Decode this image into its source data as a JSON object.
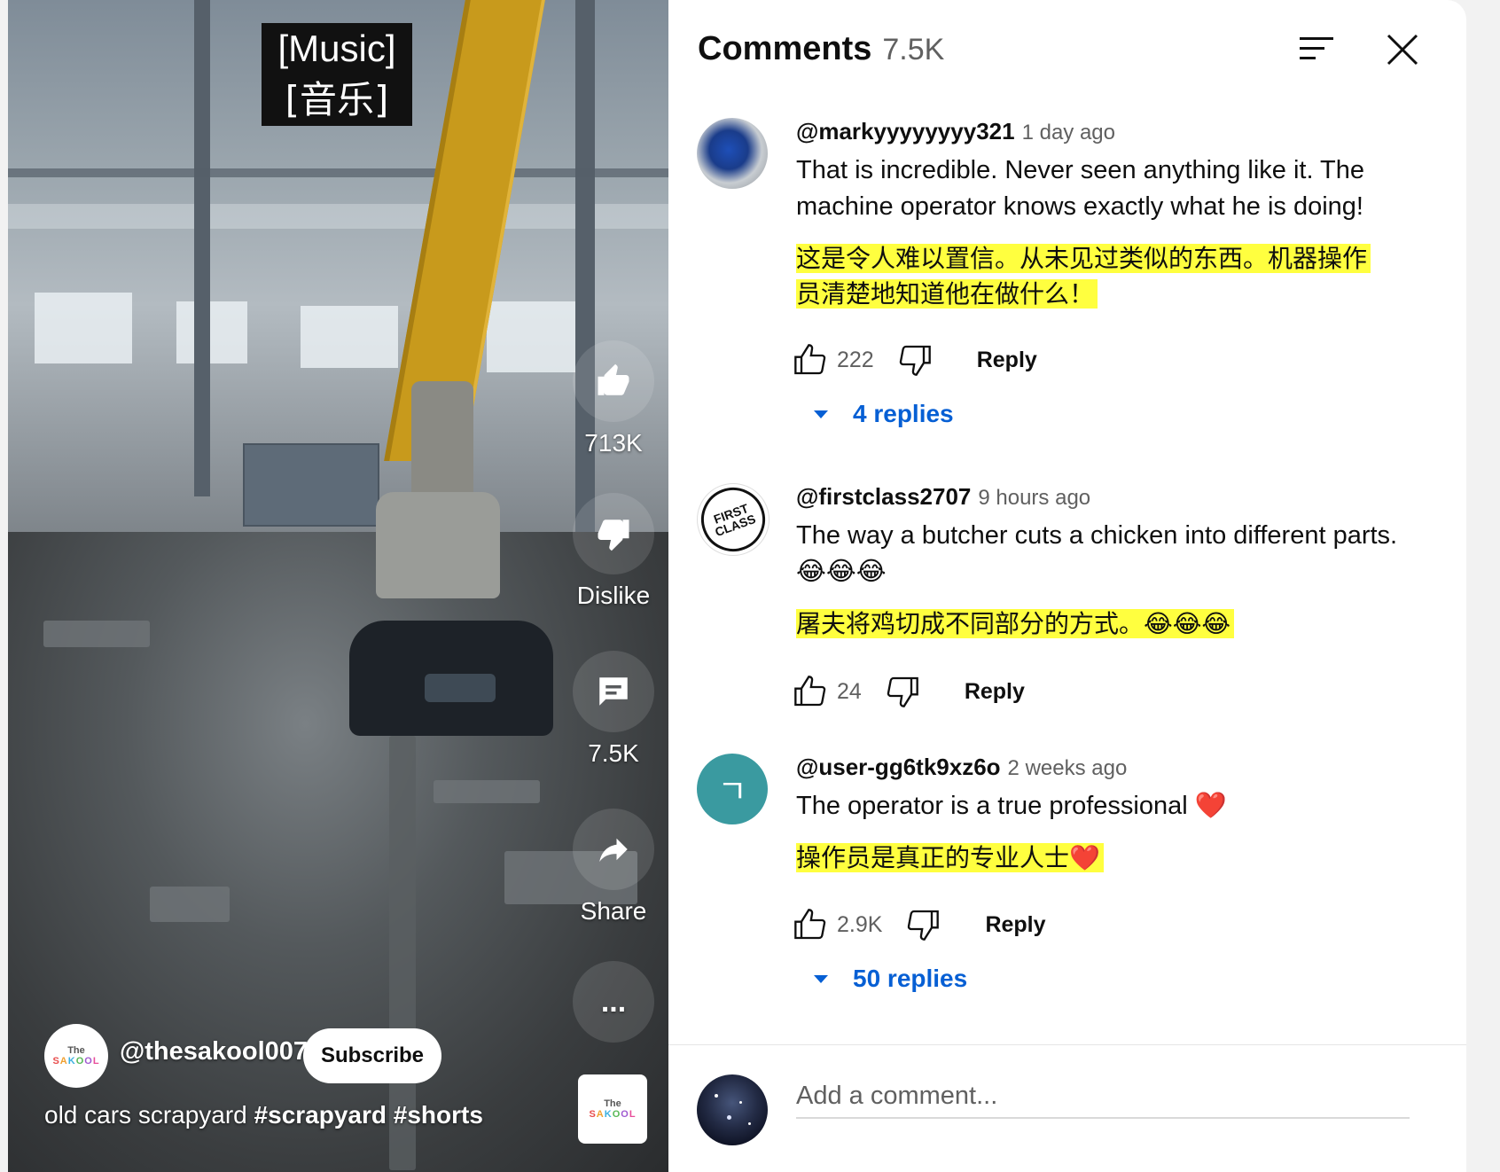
{
  "video": {
    "caption_line1": "[Music]",
    "caption_line2": "[音乐]",
    "like_count": "713K",
    "dislike_label": "Dislike",
    "comment_count": "7.5K",
    "share_label": "Share",
    "more_label": "...",
    "channel_name": "@thesakool007",
    "subscribe_label": "Subscribe",
    "title_text": "old cars scrapyard ",
    "title_tags": "#scrapyard #shorts",
    "logo_top": "The",
    "logo_letters": [
      "S",
      "A",
      "K",
      "O",
      "O",
      "L"
    ]
  },
  "comments_panel": {
    "title": "Comments",
    "count": "7.5K",
    "sort_icon": "sort-icon",
    "close_icon": "close-icon",
    "comments": [
      {
        "author": "@markyyyyyyyy321",
        "time": "1 day ago",
        "text": "That is incredible. Never seen anything like it. The machine operator knows exactly what he is doing!",
        "translation": "这是令人难以置信。从未见过类似的东西。机器操作员清楚地知道他在做什么！",
        "likes": "222",
        "reply_label": "Reply",
        "replies_label": "4 replies"
      },
      {
        "author": "@firstclass2707",
        "time": "9 hours ago",
        "text": "The way a butcher cuts a chicken into different parts. 😂😂😂",
        "translation": "屠夫将鸡切成不同部分的方式。😂😂😂",
        "likes": "24",
        "reply_label": "Reply",
        "avatar_text": "FIRST CLASS"
      },
      {
        "author": "@user-gg6tk9xz6o",
        "time": "2 weeks ago",
        "text": "The operator is a true professional ❤️",
        "translation": "操作员是真正的专业人士❤️",
        "likes": "2.9K",
        "reply_label": "Reply",
        "replies_label": "50 replies",
        "avatar_letter": "ㄱ",
        "avatar_color": "#3a9aa0"
      }
    ],
    "add_comment_placeholder": "Add a comment..."
  },
  "colors": {
    "highlight": "#ffff3f",
    "link_blue": "#065fd4",
    "caption_bg": "#111111"
  }
}
